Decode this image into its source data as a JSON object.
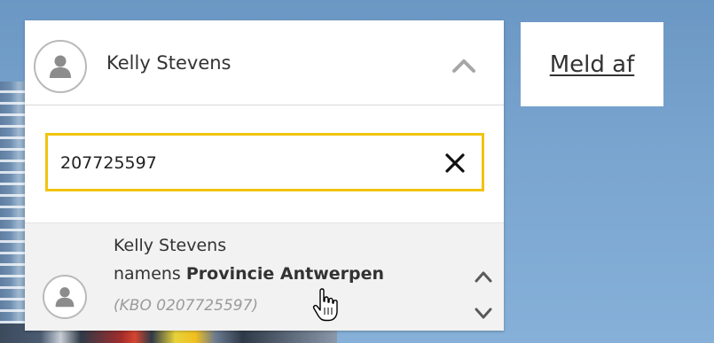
{
  "header": {
    "user_name": "Kelly Stevens",
    "logout_label": "Meld af"
  },
  "search": {
    "value": "207725597",
    "placeholder": ""
  },
  "results": [
    {
      "name": "Kelly Stevens",
      "org_prefix": "namens",
      "org_name": "Provincie Antwerpen",
      "kbo": "(KBO 0207725597)"
    }
  ],
  "icons": {
    "avatar": "user-icon",
    "toggle": "chevron-up-icon",
    "clear": "close-icon",
    "scroll_up": "chevron-up-icon",
    "scroll_down": "chevron-down-icon",
    "cursor": "hand-pointer-icon"
  },
  "colors": {
    "search_border": "#f1c40f",
    "result_bg": "#f2f2f2",
    "kbo_text": "#9a9a9a"
  }
}
